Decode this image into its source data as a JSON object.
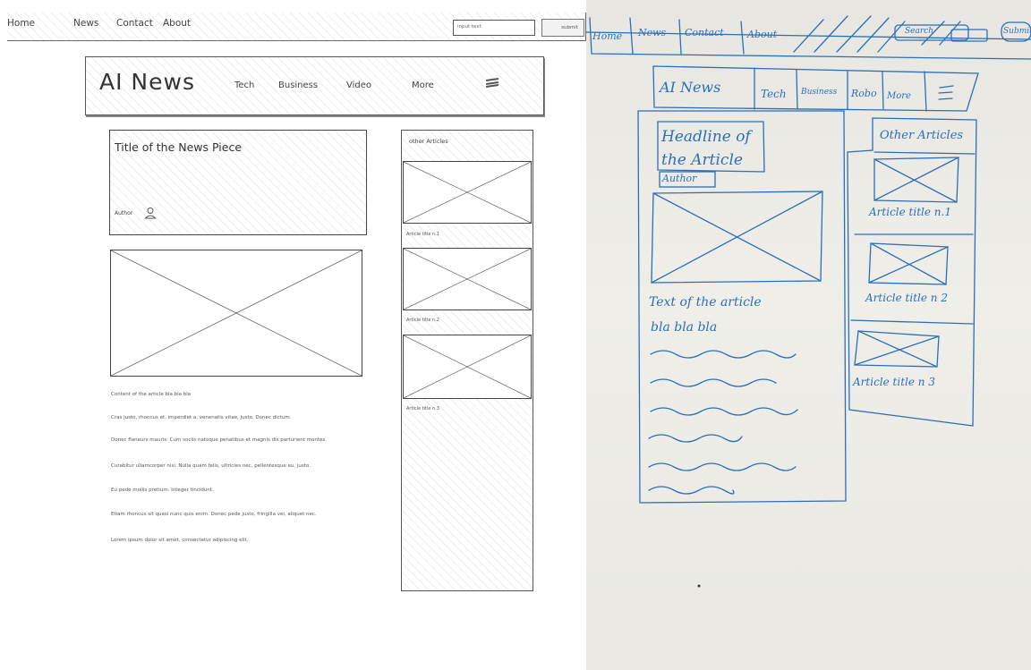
{
  "wireframe": {
    "topnav": {
      "links": [
        "Home",
        "News",
        "Contact",
        "About"
      ],
      "search_placeholder": "input text",
      "submit_label": "submit"
    },
    "header": {
      "logo": "AI News",
      "categories": [
        "Tech",
        "Business",
        "Video",
        "More"
      ]
    },
    "headline": {
      "title": "Title of the News Piece",
      "author_label": "Author"
    },
    "content": {
      "lines": [
        "Content of the article bla bla bla",
        "Cras justo, rhoncus et, imperdiet a, venenatis vitae, justo. Donec dictum.",
        "Donec flaneurs mauris. Cum sociis natoque penatibus et magnis dis parturient montes.",
        "Curabitur ullamcorper nisi. Nulla quam felis, ultricies nec, pellentesque eu, justo.",
        "Eu pede mollis pretium. Integer tincidunt.",
        "Etiam rhoncus sit quasi nunc quis enim. Donec pede justo, fringilla vel, aliquet nec.",
        "Lorem ipsum dolor sit amet, consectetur adipiscing elit."
      ]
    },
    "sidebar": {
      "title": "other Articles",
      "articles": [
        "Article title n.1",
        "Article title n.2",
        "Article title n.3"
      ]
    }
  },
  "sketch": {
    "topnav": {
      "links": [
        "Home",
        "News",
        "Contact",
        "About"
      ],
      "search_label": "Search",
      "submit_label": "Submit"
    },
    "header": {
      "logo": "AI News",
      "categories": [
        "Tech",
        "Business",
        "Robo",
        "More"
      ]
    },
    "headline": "Headline of the Article",
    "author": "Author",
    "body_lines": [
      "Text of the article",
      "bla bla bla"
    ],
    "other_articles": "Other Articles",
    "articles": [
      "Article title n.1",
      "Article title n 2",
      "Article title n 3"
    ]
  }
}
